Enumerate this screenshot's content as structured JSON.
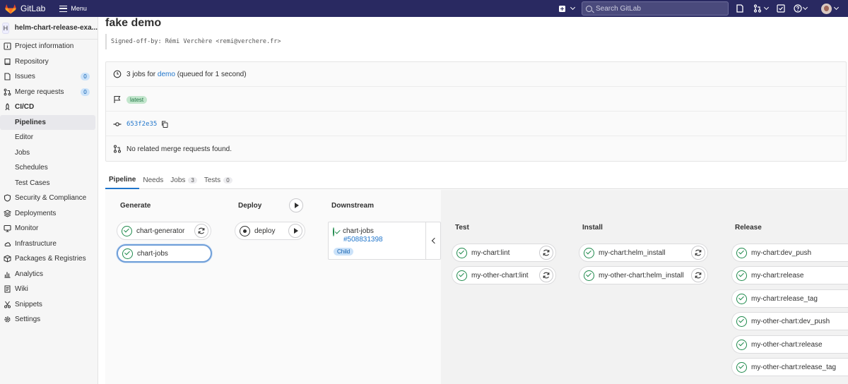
{
  "topbar": {
    "brand": "GitLab",
    "menu_label": "Menu",
    "search_placeholder": "Search GitLab"
  },
  "sidebar": {
    "project_initial": "H",
    "project_name": "helm-chart-release-exa...",
    "items": [
      {
        "label": "Project information",
        "icon": "info-icon"
      },
      {
        "label": "Repository",
        "icon": "book-icon"
      },
      {
        "label": "Issues",
        "icon": "issues-icon",
        "badge": "0"
      },
      {
        "label": "Merge requests",
        "icon": "merge-request-icon",
        "badge": "0"
      },
      {
        "label": "CI/CD",
        "icon": "rocket-icon"
      },
      {
        "label": "Pipelines",
        "sub": true,
        "active": true
      },
      {
        "label": "Editor",
        "sub": true
      },
      {
        "label": "Jobs",
        "sub": true
      },
      {
        "label": "Schedules",
        "sub": true
      },
      {
        "label": "Test Cases",
        "sub": true
      },
      {
        "label": "Security & Compliance",
        "icon": "shield-icon"
      },
      {
        "label": "Deployments",
        "icon": "deployments-icon"
      },
      {
        "label": "Monitor",
        "icon": "monitor-icon"
      },
      {
        "label": "Infrastructure",
        "icon": "cloud-icon"
      },
      {
        "label": "Packages & Registries",
        "icon": "package-icon"
      },
      {
        "label": "Analytics",
        "icon": "chart-icon"
      },
      {
        "label": "Wiki",
        "icon": "wiki-icon"
      },
      {
        "label": "Snippets",
        "icon": "snippet-icon"
      },
      {
        "label": "Settings",
        "icon": "gear-icon"
      }
    ]
  },
  "page": {
    "title": "fake demo",
    "commit_message": "Signed-off-by: Rémi Verchère <remi@verchere.fr>"
  },
  "info": {
    "jobs_prefix": "3 jobs for",
    "ref": "demo",
    "jobs_suffix": "(queued for 1 second)",
    "badge": "latest",
    "sha": "653f2e35",
    "merge_requests": "No related merge requests found."
  },
  "tabs": [
    {
      "label": "Pipeline",
      "active": true
    },
    {
      "label": "Needs"
    },
    {
      "label": "Jobs",
      "count": "3"
    },
    {
      "label": "Tests",
      "count": "0"
    }
  ],
  "pipeline": {
    "stages": {
      "generate": {
        "title": "Generate",
        "jobs": [
          "chart-generator",
          "chart-jobs"
        ]
      },
      "deploy": {
        "title": "Deploy",
        "jobs": [
          "deploy"
        ]
      },
      "downstream": {
        "title": "Downstream",
        "name": "chart-jobs",
        "id": "#508831398",
        "badge": "Child"
      },
      "test": {
        "title": "Test",
        "jobs": [
          "my-chart:lint",
          "my-other-chart:lint"
        ]
      },
      "install": {
        "title": "Install",
        "jobs": [
          "my-chart:helm_install",
          "my-other-chart:helm_install"
        ]
      },
      "release": {
        "title": "Release",
        "jobs": [
          "my-chart:dev_push",
          "my-chart:release",
          "my-chart:release_tag",
          "my-other-chart:dev_push",
          "my-other-chart:release",
          "my-other-chart:release_tag"
        ]
      }
    }
  },
  "colors": {
    "topbar": "#292961",
    "accent": "#1f75cb",
    "success": "#1f8a4c"
  }
}
